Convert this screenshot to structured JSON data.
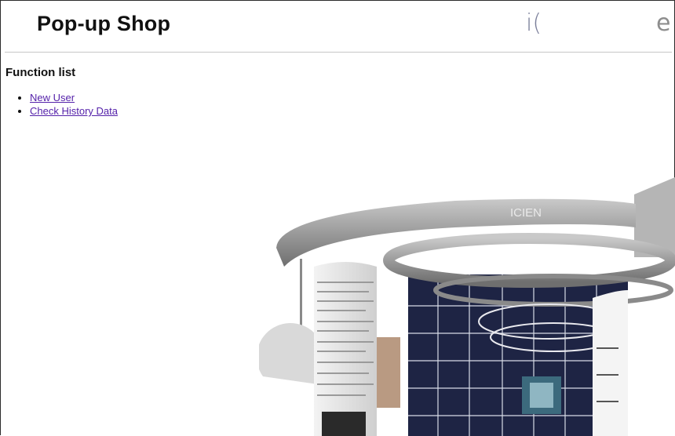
{
  "header": {
    "title": "Pop-up Shop",
    "brand_left": "i(",
    "brand_right": "e"
  },
  "function_list": {
    "heading": "Function list",
    "items": [
      {
        "label": "New User"
      },
      {
        "label": "Check History Data"
      }
    ]
  },
  "scene": {
    "booth_sign": "ICIEN"
  },
  "colors": {
    "link": "#5522aa",
    "panel_navy": "#1e2444",
    "ring_gray": "#9a9a9a"
  }
}
